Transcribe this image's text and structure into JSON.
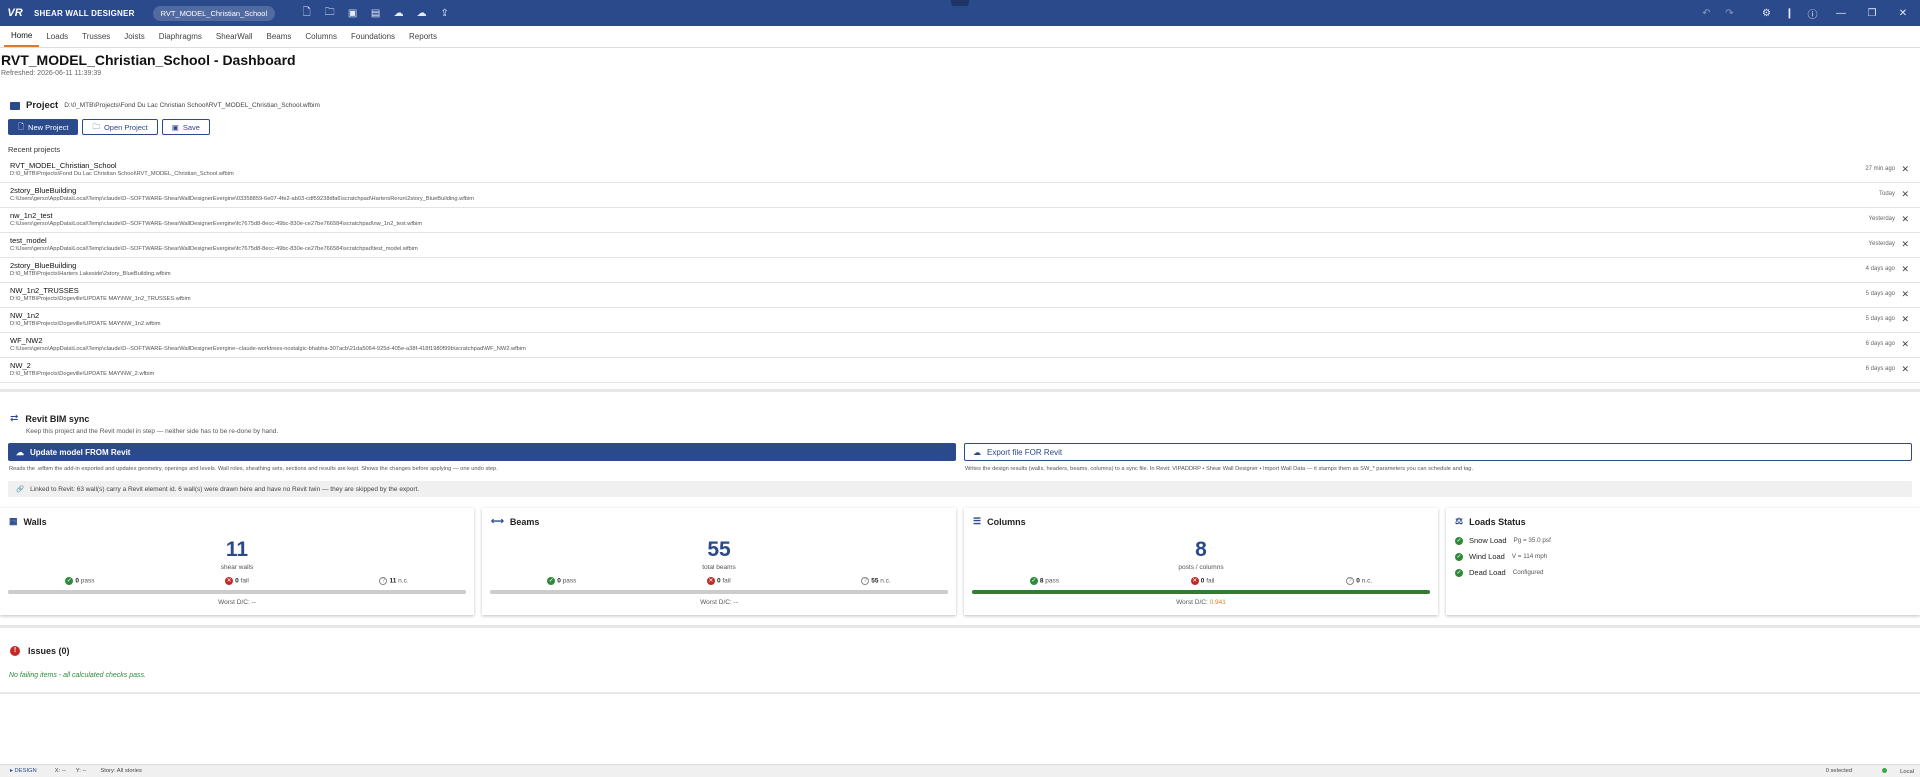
{
  "app": {
    "logo": "VR",
    "name": "SHEAR WALL DESIGNER",
    "file": "RVT_MODEL_Christian_School",
    "toolbar_icons": [
      "new-file-icon",
      "open-folder-icon",
      "save-icon",
      "save-as-icon",
      "cloud-upload-icon",
      "cloud-download-icon",
      "export-icon"
    ],
    "right_icons": [
      "undo-icon",
      "redo-icon",
      "settings-icon",
      "pin-icon",
      "info-icon",
      "minimize-icon",
      "maximize-icon",
      "close-icon"
    ]
  },
  "tabs": [
    "Home",
    "Loads",
    "Trusses",
    "Joists",
    "Diaphragms",
    "ShearWall",
    "Beams",
    "Columns",
    "Foundations",
    "Reports"
  ],
  "active_tab": "Home",
  "dashboard": {
    "title": "RVT_MODEL_Christian_School - Dashboard",
    "refreshed": "Refreshed: 2026-06-11 11:39:39"
  },
  "project": {
    "label": "Project",
    "path": "D:\\0_MTB\\Projects\\Fond Du Lac Christian School\\RVT_MODEL_Christian_School.wfbim",
    "buttons": {
      "new": "New Project",
      "open": "Open Project",
      "save": "Save"
    },
    "recent_label": "Recent projects",
    "recent": [
      {
        "name": "RVT_MODEL_Christian_School",
        "path": "D:\\0_MTB\\Projects\\Fond Du Lac Christian School\\RVT_MODEL_Christian_School.wfbim",
        "time": "27 min ago"
      },
      {
        "name": "2story_BlueBuilding",
        "path": "C:\\Users\\gerso\\AppData\\Local\\Temp\\claude\\D--SOFTWARE-ShearWallDesignerEvergine\\03358859-6e07-4fe2-ab03-cdf59238dfa6\\scratchpad\\HartersRerun\\2story_BlueBuilding.wfbim",
        "time": "Today"
      },
      {
        "name": "nw_1n2_test",
        "path": "C:\\Users\\gerso\\AppData\\Local\\Temp\\claude\\D--SOFTWARE-ShearWallDesignerEvergine\\fc7675d8-8ecc-49bc-830e-ce27be766584\\scratchpad\\nw_1n2_test.wfbim",
        "time": "Yesterday"
      },
      {
        "name": "test_model",
        "path": "C:\\Users\\gerso\\AppData\\Local\\Temp\\claude\\D--SOFTWARE-ShearWallDesignerEvergine\\fc7675d8-8ecc-49bc-830e-ce27be766584\\scratchpad\\test_model.wfbim",
        "time": "Yesterday"
      },
      {
        "name": "2story_BlueBuilding",
        "path": "D:\\0_MTB\\Projects\\Harters Lakeside\\2story_BlueBuilding.wfbim",
        "time": "4 days ago"
      },
      {
        "name": "NW_1n2_TRUSSES",
        "path": "D:\\0_MTB\\Projects\\Dogeville\\UPDATE MAY\\NW_1n2_TRUSSES.wfbim",
        "time": "5 days ago"
      },
      {
        "name": "NW_1n2",
        "path": "D:\\0_MTB\\Projects\\Dogeville\\UPDATE MAY\\NW_1n2.wfbim",
        "time": "5 days ago"
      },
      {
        "name": "WF_NW2",
        "path": "C:\\Users\\gerso\\AppData\\Local\\Temp\\claude\\D--SOFTWARE-ShearWallDesignerEvergine--claude-worktrees-nostalgic-bhabha-307acb\\21da5064-925d-405e-a38f-418f1980f99b\\scratchpad\\WF_NW2.wfbim",
        "time": "6 days ago"
      },
      {
        "name": "NW_2",
        "path": "D:\\0_MTB\\Projects\\Dogeville\\UPDATE MAY\\NW_2.wfbim",
        "time": "6 days ago"
      }
    ]
  },
  "sync": {
    "title": "Revit BIM sync",
    "subtitle": "Keep this project and the Revit model in step — neither side has to be re-done by hand.",
    "update_label": "Update model FROM Revit",
    "update_note": "Reads the .wfbim the add-in exported and updates geometry, openings and levels. Wall roles, sheathing sets, sections and results are kept. Shows the changes before applying — one undo step.",
    "export_label": "Export file FOR Revit",
    "export_note": "Writes the design results (walls, headers, beams, columns) to a sync file. In Revit: VIPADDRP • Shear Wall Designer • Import Wall Data — it stamps them as SW_* parameters you can schedule and tag.",
    "link_note": "Linked to Revit: 63 wall(s) carry a Revit element id. 6 wall(s) were drawn here and have no Revit twin — they are skipped by the export."
  },
  "cards": [
    {
      "title": "Walls",
      "count": "11",
      "unit": "shear walls",
      "pass": "0",
      "fail": "0",
      "nc": "11",
      "fill": 0,
      "worst": "Worst D/C: --",
      "worst_val": ""
    },
    {
      "title": "Beams",
      "count": "55",
      "unit": "total beams",
      "pass": "0",
      "fail": "0",
      "nc": "55",
      "fill": 0,
      "worst": "Worst D/C: --",
      "worst_val": ""
    },
    {
      "title": "Columns",
      "count": "8",
      "unit": "posts / columns",
      "pass": "8",
      "fail": "0",
      "nc": "0",
      "fill": 1.0,
      "worst": "Worst D/C:",
      "worst_val": "0.941"
    }
  ],
  "stat_labels": {
    "pass": "pass",
    "fail": "fail",
    "nc": "n.c."
  },
  "loads": {
    "title": "Loads Status",
    "items": [
      {
        "label": "Snow Load",
        "value": "Pg = 35.0 psf"
      },
      {
        "label": "Wind Load",
        "value": "V = 114 mph"
      },
      {
        "label": "Dead Load",
        "value": "Configured"
      }
    ]
  },
  "issues": {
    "title": "Issues (0)",
    "ok_text": "No failing items - all calculated checks pass."
  },
  "status": {
    "mode": "▸ DESIGN",
    "x": "X: --",
    "y": "Y: --",
    "story": "Story: All stories",
    "selected": "0 selected",
    "local": "Local"
  },
  "colors": {
    "brand": "#2b4a8c",
    "pass": "#2e8b3c",
    "fail": "#c62828",
    "accent": "#e07b25"
  }
}
